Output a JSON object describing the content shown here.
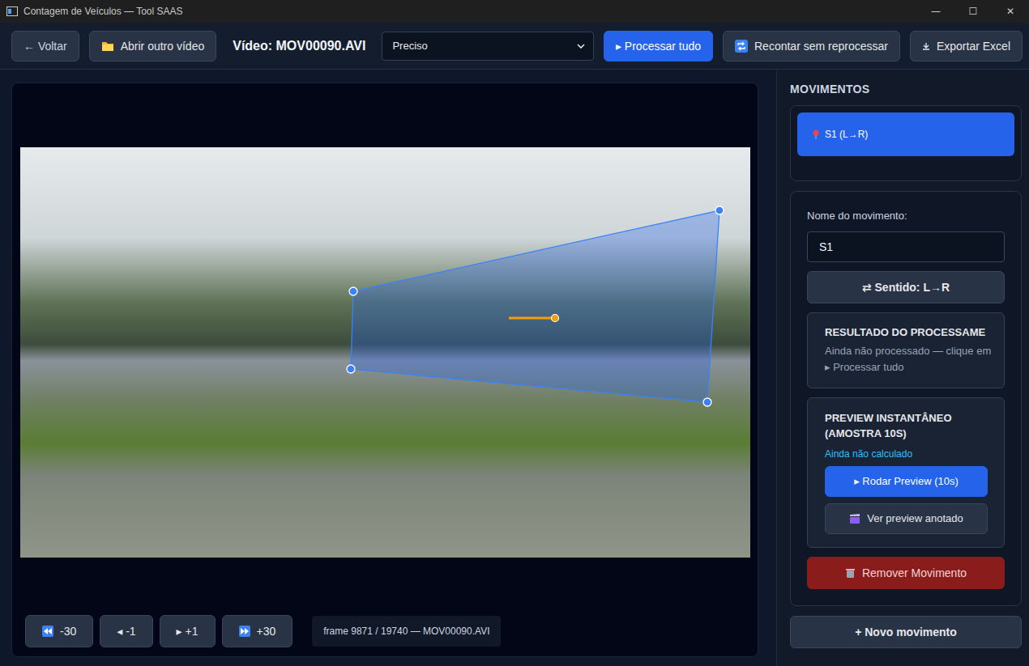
{
  "window": {
    "title": "Contagem de Veículos — Tool SAAS",
    "controls": [
      "—",
      "☐",
      "✕"
    ]
  },
  "toolbar": {
    "back_button": "← Voltar",
    "open_button": "Abrir outro vídeo",
    "video_label": "Vídeo: MOV00090.AVI",
    "mode_select": "Preciso",
    "process_button": "▸ Processar tudo",
    "recount_button": "Recontar sem reprocessar",
    "export_button": "Exportar Excel"
  },
  "player": {
    "controls": [
      {
        "label": "-30",
        "kind": "rewind"
      },
      {
        "label": "◂ -1",
        "kind": "step"
      },
      {
        "label": "▸ +1",
        "kind": "step"
      },
      {
        "label": "+30",
        "kind": "forward"
      }
    ],
    "frame_info": "frame 9871 / 19740 — MOV00090.AVI"
  },
  "sidebar": {
    "heading": "MOVIMENTOS",
    "movements": [
      {
        "label": "S1 (L→R)",
        "selected": true
      }
    ],
    "editor": {
      "name_label": "Nome do movimento:",
      "name_value": "S1",
      "direction_button": "⇄ Sentido: L→R",
      "result": {
        "title": "RESULTADO DO PROCESSAME",
        "text": "Ainda não processado — clique em ▸ Processar tudo"
      },
      "preview": {
        "title": "PREVIEW INSTANTÂNEO (AMOSTRA 10S)",
        "status": "Ainda não calculado",
        "run_button": "▸ Rodar Preview (10s)",
        "annotated_button": "Ver preview anotado"
      },
      "remove_button": "Remover Movimento"
    },
    "new_button": "+ Novo movimento"
  }
}
